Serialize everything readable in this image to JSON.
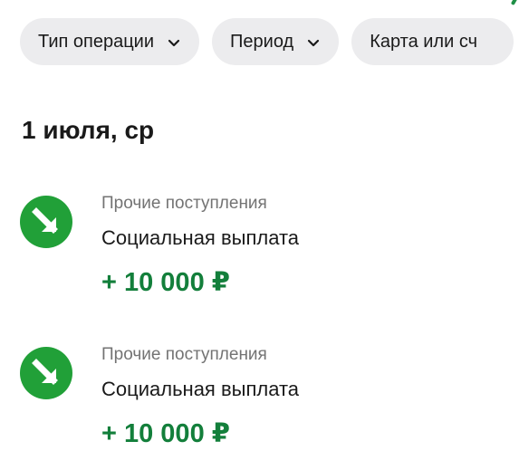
{
  "filters": {
    "operation_type": "Тип операции",
    "period": "Период",
    "card_or_account": "Карта или сч"
  },
  "date_group": {
    "label": "1 июля, ср"
  },
  "transactions": [
    {
      "category": "Прочие поступления",
      "title": "Социальная выплата",
      "amount": "+ 10 000 ₽",
      "icon": "incoming-arrow-icon"
    },
    {
      "category": "Прочие поступления",
      "title": "Социальная выплата",
      "amount": "+ 10 000 ₽",
      "icon": "incoming-arrow-icon"
    }
  ],
  "colors": {
    "accent_green": "#21a038",
    "amount_green": "#137f3b",
    "chip_bg": "#ececee",
    "muted_text": "#737373"
  }
}
